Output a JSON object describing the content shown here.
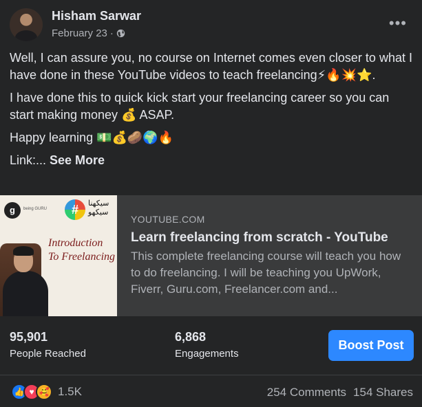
{
  "post": {
    "author": "Hisham Sarwar",
    "date": "February 23",
    "separator": "·",
    "audience_icon": "globe-icon",
    "menu_icon": "more-horizontal-icon",
    "paragraphs": [
      "Well, I can assure you, no course on Internet comes even closer to what I have done in these YouTube videos to teach freelancing⚡🔥💥⭐.",
      "I have done this to quick kick start your freelancing career so you can start making money 💰 ASAP.",
      "Happy learning 💵💰🥔🌍🔥"
    ],
    "truncated_prefix": "Link:... ",
    "see_more": "See More"
  },
  "link_preview": {
    "domain": "YOUTUBE.COM",
    "title": "Learn freelancing from scratch - YouTube",
    "description": "This complete freelancing course will teach you how to do freelancing. I will be teaching you UpWork, Fiverr, Guru.com, Freelancer.com and...",
    "thumbnail": {
      "logo_letter": "g",
      "brand_text": "being GURU",
      "hash_symbol": "#",
      "urdu_text": "سیکھنا سیکھو",
      "overlay_line1": "Introduction",
      "overlay_line2": "To Freelancing"
    }
  },
  "insights": {
    "reached": {
      "value": "95,901",
      "label": "People Reached"
    },
    "engagements": {
      "value": "6,868",
      "label": "Engagements"
    },
    "boost_label": "Boost Post",
    "boost_color": "#2d88ff"
  },
  "engagement_bar": {
    "reaction_icons": [
      "like-icon",
      "love-icon",
      "care-icon"
    ],
    "reactions_count": "1.5K",
    "comments": "254 Comments",
    "shares": "154 Shares"
  },
  "colors": {
    "card_background": "#242526",
    "primary_text": "#e4e6eb",
    "secondary_text": "#b0b3b8",
    "preview_background": "#3a3b3c"
  }
}
